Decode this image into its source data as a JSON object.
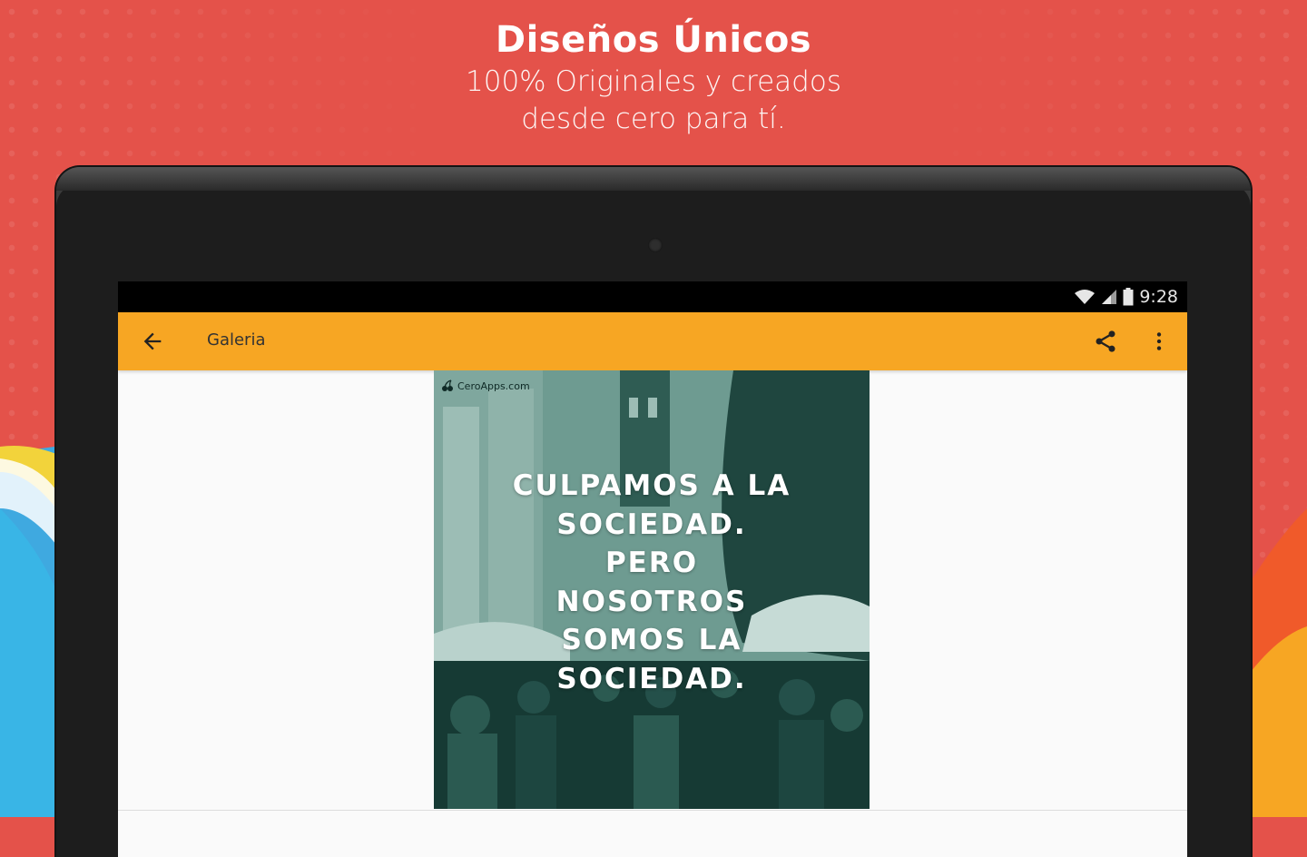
{
  "promo": {
    "title": "Diseños Únicos",
    "subtitle_line1": "100% Originales y creados",
    "subtitle_line2": "desde cero para tí."
  },
  "status_bar": {
    "time": "9:28",
    "icons": [
      "wifi-icon",
      "signal-icon",
      "battery-icon"
    ]
  },
  "toolbar": {
    "title": "Galeria",
    "back_icon": "arrow-left-icon",
    "share_icon": "share-icon",
    "more_icon": "more-vert-icon"
  },
  "poster": {
    "brand": "CeroApps.com",
    "lines": [
      "CULPAMOS A LA",
      "SOCIEDAD.",
      "PERO",
      "NOSOTROS",
      "SOMOS LA",
      "SOCIEDAD."
    ]
  },
  "colors": {
    "background": "#e4524a",
    "toolbar": "#f7a623",
    "poster_tint": "#5d8a80"
  }
}
